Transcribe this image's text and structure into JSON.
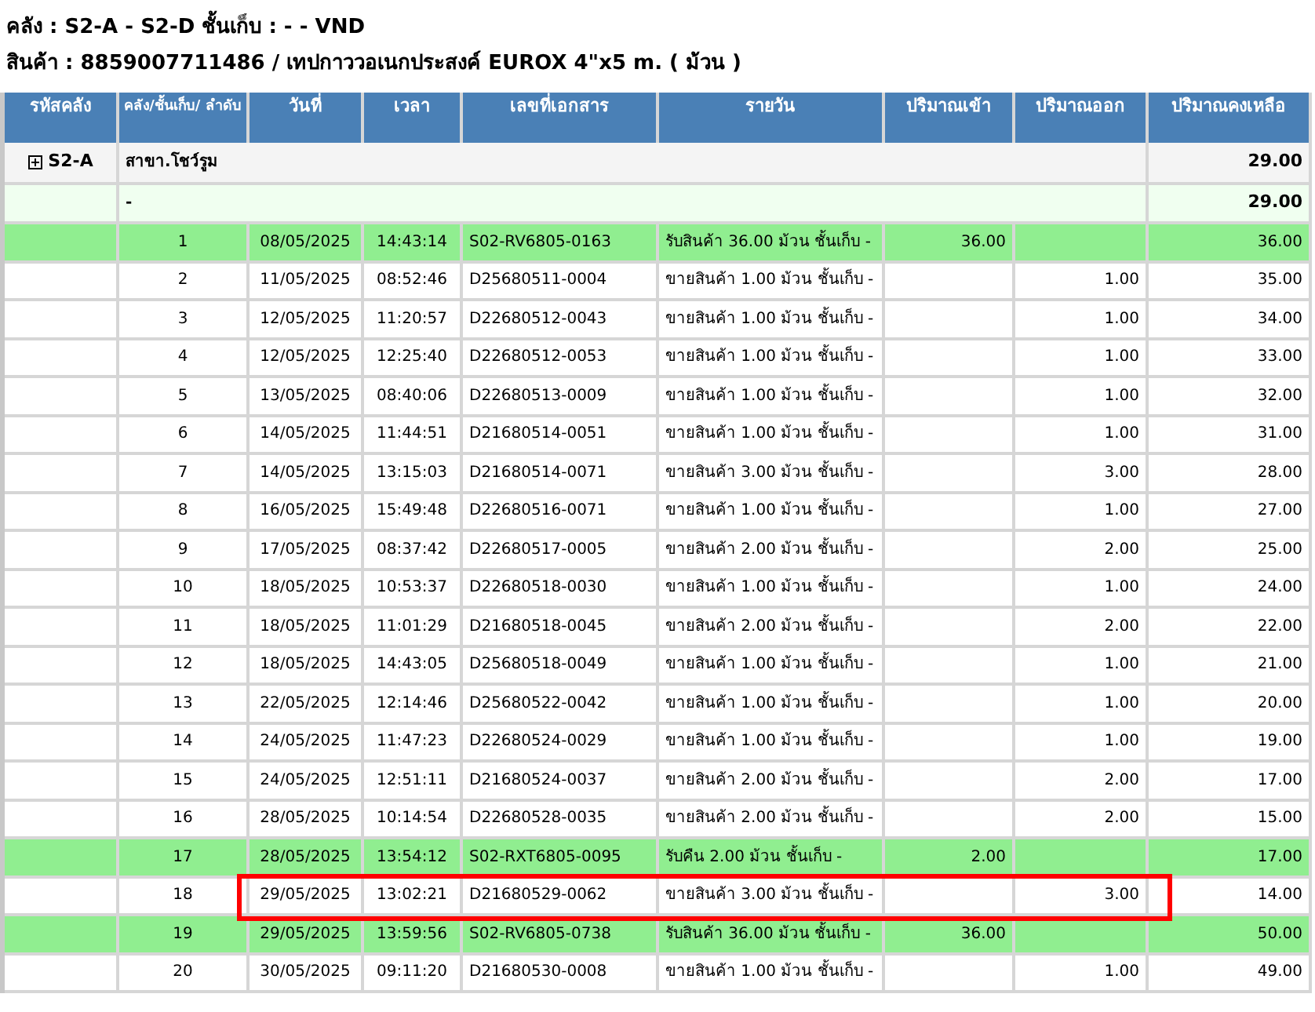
{
  "header_lines": [
    "คลัง : S2-A - S2-D ชั้นเก็บ : - - VND",
    "สินค้า : 8859007711486 / เทปกาววอเนกประสงค์ EUROX 4\"x5 m. ( ม้วน )"
  ],
  "table": {
    "columns": [
      "รหัสคลัง",
      "คลัง/ชั้นเก็บ/ ลำดับ",
      "วันที่",
      "เวลา",
      "เลขที่เอกสาร",
      "รายวัน",
      "ปริมาณเข้า",
      "ปริมาณออก",
      "ปริมาณคงเหลือ"
    ],
    "group": {
      "code": "S2-A",
      "expanded": false,
      "name": "สาขา.โชว์รูม",
      "balance": "29.00"
    },
    "subgroup": {
      "label": "-",
      "balance": "29.00"
    },
    "rows": [
      {
        "kind": "in",
        "seq": "1",
        "date": "08/05/2025",
        "time": "14:43:14",
        "doc": "S02-RV6805-0163",
        "desc": "รับสินค้า 36.00 ม้วน ชั้นเก็บ -",
        "qty_in": "36.00",
        "qty_out": "",
        "balance": "36.00",
        "boxed": false
      },
      {
        "kind": "out",
        "seq": "2",
        "date": "11/05/2025",
        "time": "08:52:46",
        "doc": "D25680511-0004",
        "desc": "ขายสินค้า 1.00 ม้วน ชั้นเก็บ -",
        "qty_in": "",
        "qty_out": "1.00",
        "balance": "35.00",
        "boxed": false
      },
      {
        "kind": "out",
        "seq": "3",
        "date": "12/05/2025",
        "time": "11:20:57",
        "doc": "D22680512-0043",
        "desc": "ขายสินค้า 1.00 ม้วน ชั้นเก็บ -",
        "qty_in": "",
        "qty_out": "1.00",
        "balance": "34.00",
        "boxed": false
      },
      {
        "kind": "out",
        "seq": "4",
        "date": "12/05/2025",
        "time": "12:25:40",
        "doc": "D22680512-0053",
        "desc": "ขายสินค้า 1.00 ม้วน ชั้นเก็บ -",
        "qty_in": "",
        "qty_out": "1.00",
        "balance": "33.00",
        "boxed": false
      },
      {
        "kind": "out",
        "seq": "5",
        "date": "13/05/2025",
        "time": "08:40:06",
        "doc": "D22680513-0009",
        "desc": "ขายสินค้า 1.00 ม้วน ชั้นเก็บ -",
        "qty_in": "",
        "qty_out": "1.00",
        "balance": "32.00",
        "boxed": false
      },
      {
        "kind": "out",
        "seq": "6",
        "date": "14/05/2025",
        "time": "11:44:51",
        "doc": "D21680514-0051",
        "desc": "ขายสินค้า 1.00 ม้วน ชั้นเก็บ -",
        "qty_in": "",
        "qty_out": "1.00",
        "balance": "31.00",
        "boxed": false
      },
      {
        "kind": "out",
        "seq": "7",
        "date": "14/05/2025",
        "time": "13:15:03",
        "doc": "D21680514-0071",
        "desc": "ขายสินค้า 3.00 ม้วน ชั้นเก็บ -",
        "qty_in": "",
        "qty_out": "3.00",
        "balance": "28.00",
        "boxed": false
      },
      {
        "kind": "out",
        "seq": "8",
        "date": "16/05/2025",
        "time": "15:49:48",
        "doc": "D22680516-0071",
        "desc": "ขายสินค้า 1.00 ม้วน ชั้นเก็บ -",
        "qty_in": "",
        "qty_out": "1.00",
        "balance": "27.00",
        "boxed": false
      },
      {
        "kind": "out",
        "seq": "9",
        "date": "17/05/2025",
        "time": "08:37:42",
        "doc": "D22680517-0005",
        "desc": "ขายสินค้า 2.00 ม้วน ชั้นเก็บ -",
        "qty_in": "",
        "qty_out": "2.00",
        "balance": "25.00",
        "boxed": false
      },
      {
        "kind": "out",
        "seq": "10",
        "date": "18/05/2025",
        "time": "10:53:37",
        "doc": "D22680518-0030",
        "desc": "ขายสินค้า 1.00 ม้วน ชั้นเก็บ -",
        "qty_in": "",
        "qty_out": "1.00",
        "balance": "24.00",
        "boxed": false
      },
      {
        "kind": "out",
        "seq": "11",
        "date": "18/05/2025",
        "time": "11:01:29",
        "doc": "D21680518-0045",
        "desc": "ขายสินค้า 2.00 ม้วน ชั้นเก็บ -",
        "qty_in": "",
        "qty_out": "2.00",
        "balance": "22.00",
        "boxed": false
      },
      {
        "kind": "out",
        "seq": "12",
        "date": "18/05/2025",
        "time": "14:43:05",
        "doc": "D25680518-0049",
        "desc": "ขายสินค้า 1.00 ม้วน ชั้นเก็บ -",
        "qty_in": "",
        "qty_out": "1.00",
        "balance": "21.00",
        "boxed": false
      },
      {
        "kind": "out",
        "seq": "13",
        "date": "22/05/2025",
        "time": "12:14:46",
        "doc": "D25680522-0042",
        "desc": "ขายสินค้า 1.00 ม้วน ชั้นเก็บ -",
        "qty_in": "",
        "qty_out": "1.00",
        "balance": "20.00",
        "boxed": false
      },
      {
        "kind": "out",
        "seq": "14",
        "date": "24/05/2025",
        "time": "11:47:23",
        "doc": "D22680524-0029",
        "desc": "ขายสินค้า 1.00 ม้วน ชั้นเก็บ -",
        "qty_in": "",
        "qty_out": "1.00",
        "balance": "19.00",
        "boxed": false
      },
      {
        "kind": "out",
        "seq": "15",
        "date": "24/05/2025",
        "time": "12:51:11",
        "doc": "D21680524-0037",
        "desc": "ขายสินค้า 2.00 ม้วน ชั้นเก็บ -",
        "qty_in": "",
        "qty_out": "2.00",
        "balance": "17.00",
        "boxed": false
      },
      {
        "kind": "out",
        "seq": "16",
        "date": "28/05/2025",
        "time": "10:14:54",
        "doc": "D22680528-0035",
        "desc": "ขายสินค้า 2.00 ม้วน ชั้นเก็บ -",
        "qty_in": "",
        "qty_out": "2.00",
        "balance": "15.00",
        "boxed": false
      },
      {
        "kind": "in",
        "seq": "17",
        "date": "28/05/2025",
        "time": "13:54:12",
        "doc": "S02-RXT6805-0095",
        "desc": "รับคืน 2.00 ม้วน ชั้นเก็บ -",
        "qty_in": "2.00",
        "qty_out": "",
        "balance": "17.00",
        "boxed": false
      },
      {
        "kind": "out",
        "seq": "18",
        "date": "29/05/2025",
        "time": "13:02:21",
        "doc": "D21680529-0062",
        "desc": "ขายสินค้า 3.00 ม้วน ชั้นเก็บ -",
        "qty_in": "",
        "qty_out": "3.00",
        "balance": "14.00",
        "boxed": true
      },
      {
        "kind": "in",
        "seq": "19",
        "date": "29/05/2025",
        "time": "13:59:56",
        "doc": "S02-RV6805-0738",
        "desc": "รับสินค้า 36.00 ม้วน ชั้นเก็บ -",
        "qty_in": "36.00",
        "qty_out": "",
        "balance": "50.00",
        "boxed": false
      },
      {
        "kind": "out",
        "seq": "20",
        "date": "30/05/2025",
        "time": "09:11:20",
        "doc": "D21680530-0008",
        "desc": "ขายสินค้า 1.00 ม้วน ชั้นเก็บ -",
        "qty_in": "",
        "qty_out": "1.00",
        "balance": "49.00",
        "boxed": false
      }
    ]
  }
}
